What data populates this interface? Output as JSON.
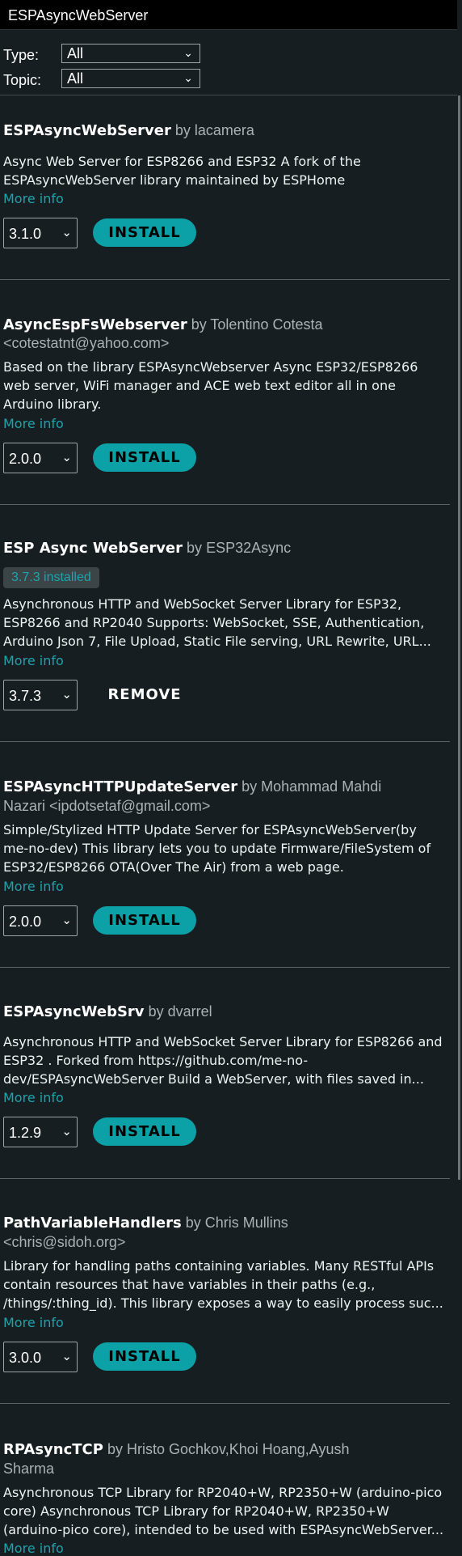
{
  "search": {
    "value": "ESPAsyncWebServer"
  },
  "filters": {
    "type_label": "Type:",
    "type_value": "All",
    "topic_label": "Topic:",
    "topic_value": "All"
  },
  "libraries": [
    {
      "name": "ESPAsyncWebServer",
      "by": "by",
      "author": "lacamera",
      "author_line2": "",
      "installed_badge": "",
      "description": [
        "Async Web Server for ESP8266 and ESP32 A fork of the",
        "ESPAsyncWebServer library maintained by ESPHome"
      ],
      "more_info": "More info",
      "version": "3.1.0",
      "action": "INSTALL"
    },
    {
      "name": "AsyncEspFsWebserver",
      "by": "by",
      "author": "Tolentino Cotesta",
      "author_line2": "<cotestatnt@yahoo.com>",
      "installed_badge": "",
      "description": [
        "Based on the library ESPAsyncWebserver Async ESP32/ESP8266",
        "web server, WiFi manager and ACE web text editor all in one",
        "Arduino library."
      ],
      "more_info": "More info",
      "version": "2.0.0",
      "action": "INSTALL"
    },
    {
      "name": "ESP Async WebServer",
      "by": "by",
      "author": "ESP32Async",
      "author_line2": "",
      "installed_badge": "3.7.3 installed",
      "description": [
        "Asynchronous HTTP and WebSocket Server Library for ESP32,",
        "ESP8266 and RP2040 Supports: WebSocket, SSE, Authentication,",
        "Arduino Json 7, File Upload, Static File serving, URL Rewrite, URL..."
      ],
      "more_info": "More info",
      "version": "3.7.3",
      "action": "REMOVE"
    },
    {
      "name": "ESPAsyncHTTPUpdateServer",
      "by": "by",
      "author": "Mohammad Mahdi",
      "author_line2": "Nazari <ipdotsetaf@gmail.com>",
      "installed_badge": "",
      "description": [
        "Simple/Stylized HTTP Update Server for ESPAsyncWebServer(by",
        "me-no-dev) This library lets you to update Firmware/FileSystem of",
        "ESP32/ESP8266 OTA(Over The Air) from a web page."
      ],
      "more_info": "More info",
      "version": "2.0.0",
      "action": "INSTALL"
    },
    {
      "name": "ESPAsyncWebSrv",
      "by": "by",
      "author": "dvarrel",
      "author_line2": "",
      "installed_badge": "",
      "description": [
        "Asynchronous HTTP and WebSocket Server Library for ESP8266 and",
        "ESP32 . Forked from https://github.com/me-no-",
        "dev/ESPAsyncWebServer Build a WebServer, with files saved in..."
      ],
      "more_info": "More info",
      "version": "1.2.9",
      "action": "INSTALL"
    },
    {
      "name": "PathVariableHandlers",
      "by": "by",
      "author": "Chris Mullins",
      "author_line2": "<chris@sidoh.org>",
      "installed_badge": "",
      "description": [
        "Library for handling paths containing variables. Many RESTful APIs",
        "contain resources that have variables in their paths (e.g.,",
        "/things/:thing_id). This library exposes a way to easily process suc..."
      ],
      "more_info": "More info",
      "version": "3.0.0",
      "action": "INSTALL"
    },
    {
      "name": "RPAsyncTCP",
      "by": "by",
      "author": "Hristo Gochkov,Khoi Hoang,Ayush",
      "author_line2": "Sharma",
      "installed_badge": "",
      "description": [
        "Asynchronous TCP Library for RP2040+W, RP2350+W (arduino-pico",
        "core) Asynchronous TCP Library for RP2040+W, RP2350+W",
        "(arduino-pico core), intended to be used with ESPAsyncWebServer..."
      ],
      "more_info": "More info",
      "version": "",
      "action": ""
    }
  ]
}
